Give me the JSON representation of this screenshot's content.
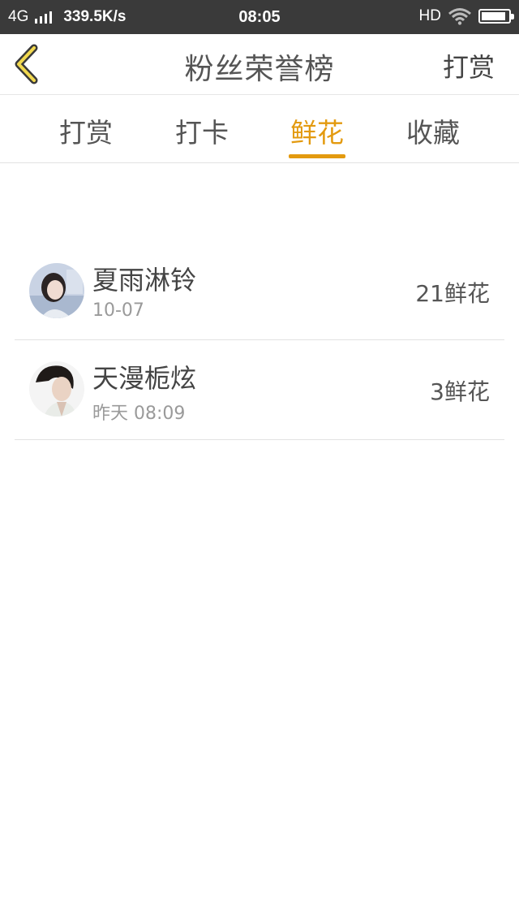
{
  "status_bar": {
    "network": "4G",
    "speed": "339.5K/s",
    "time": "08:05",
    "hd": "HD",
    "signal_icon": "signal-bars-icon",
    "wifi_icon": "wifi-icon",
    "battery_icon": "battery-icon",
    "battery_level": 0.9
  },
  "header": {
    "back_icon": "chevron-left-icon",
    "title": "粉丝荣誉榜",
    "action_label": "打赏"
  },
  "tabs": [
    {
      "label": "打赏",
      "active": false
    },
    {
      "label": "打卡",
      "active": false
    },
    {
      "label": "鲜花",
      "active": true
    },
    {
      "label": "收藏",
      "active": false
    }
  ],
  "colors": {
    "accent": "#e39a0f",
    "status_bar_bg": "#3a3a3a"
  },
  "fans": [
    {
      "name": "夏雨淋铃",
      "time": "10-07",
      "count": "21鲜花"
    },
    {
      "name": "天漫栀炫",
      "time": "昨天 08:09",
      "count": "3鲜花"
    }
  ]
}
